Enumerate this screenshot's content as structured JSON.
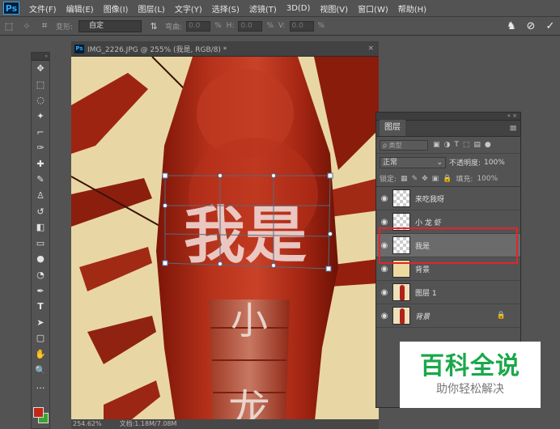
{
  "menu": {
    "logo": "Ps",
    "items": [
      "文件(F)",
      "编辑(E)",
      "图像(I)",
      "图层(L)",
      "文字(Y)",
      "选择(S)",
      "滤镜(T)",
      "3D(D)",
      "视图(V)",
      "窗口(W)",
      "帮助(H)"
    ]
  },
  "options": {
    "transform_label": "变形:",
    "transform_value": "自定",
    "bend_label": "弯曲:",
    "bend_value": "0.0",
    "h_label": "H:",
    "h_value": "0.0",
    "v_label": "V:",
    "v_value": "0.0",
    "pct": "%"
  },
  "document": {
    "tab_title": "IMG_2226.JPG @ 255% (我是, RGB/8) *",
    "canvas_text_main": "我是",
    "canvas_text_small1": "小",
    "canvas_text_small2": "龙"
  },
  "status": {
    "zoom": "254.62%",
    "file_info": "文档:1.18M/7.08M"
  },
  "layers_panel": {
    "tab": "图层",
    "filter_placeholder": "ρ 类型",
    "blend_mode": "正常",
    "opacity_label": "不透明度:",
    "opacity_value": "100%",
    "lock_label": "锁定:",
    "fill_label": "填充:",
    "fill_value": "100%",
    "layers": [
      {
        "name": "来吃我呀",
        "thumb": "check",
        "selected": false,
        "italic": false,
        "locked": false
      },
      {
        "name": "小 龙 虾",
        "thumb": "check",
        "selected": false,
        "italic": false,
        "locked": false
      },
      {
        "name": "我是",
        "thumb": "check",
        "selected": true,
        "italic": false,
        "locked": false
      },
      {
        "name": "背景",
        "thumb": "beige",
        "selected": false,
        "italic": false,
        "locked": false
      },
      {
        "name": "图层 1",
        "thumb": "shrimp",
        "selected": false,
        "italic": false,
        "locked": false
      },
      {
        "name": "背景",
        "thumb": "shrimp",
        "selected": false,
        "italic": true,
        "locked": true
      }
    ]
  },
  "watermark": {
    "title": "百科全说",
    "subtitle": "助你轻松解决"
  },
  "colors": {
    "foreground": "#c1271a",
    "background": "#3ba430",
    "highlight_outline": "#e0262a",
    "watermark_green": "#1aa84a"
  }
}
